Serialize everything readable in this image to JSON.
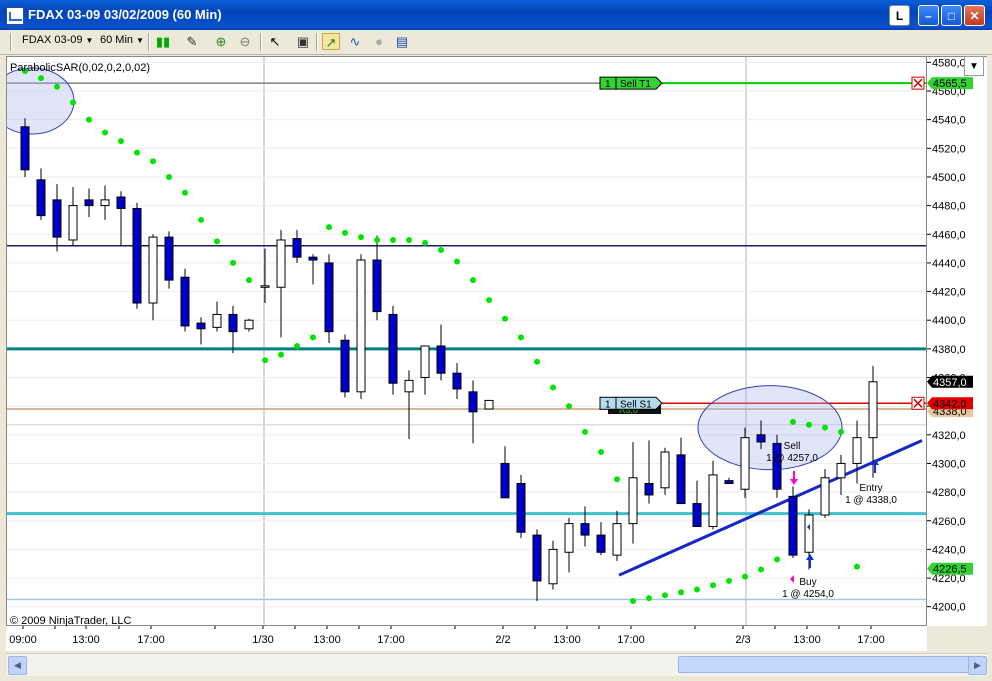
{
  "window": {
    "title": "FDAX 03-09  03/02/2009 (60 Min)",
    "btn_l": "L"
  },
  "toolbar": {
    "instrument": "FDAX 03-09",
    "interval": "60 Min"
  },
  "chart": {
    "indicator_label": "ParabolicSAR(0,02,0,2,0,02)",
    "copyright": "© 2009 NinjaTrader, LLC",
    "price_ticks": [
      "4580,0",
      "4560,0",
      "4540,0",
      "4520,0",
      "4500,0",
      "4480,0",
      "4460,0",
      "4440,0",
      "4420,0",
      "4400,0",
      "4380,0",
      "4360,0",
      "4340,0",
      "4320,0",
      "4300,0",
      "4280,0",
      "4260,0",
      "4240,0",
      "4220,0",
      "4200,0"
    ],
    "time_ticks": [
      "09:00",
      "13:00",
      "17:00",
      "1/30",
      "13:00",
      "17:00",
      "2/2",
      "13:00",
      "17:00",
      "2/3",
      "13:00",
      "17:00"
    ],
    "price_flags": {
      "last": "4357,0",
      "sell_target": "4565,5",
      "sell_stop": "4342,0",
      "sell_stop_back": "4338,0",
      "stop_green": "4226,5"
    },
    "order_tags": {
      "target_qty": "1",
      "target_label": "Sell T1",
      "stop_qty": "1",
      "stop_label": "Sell S1",
      "stop_under": "R3,0"
    },
    "annotations": {
      "sell_line1": "Sell",
      "sell_line2": "1 @ 4257,0",
      "buy_line1": "Buy",
      "buy_line2": "1 @ 4254,0",
      "entry_line1": "Entry",
      "entry_line2": "1 @ 4338,0"
    },
    "colors": {
      "sar": "#00E400",
      "bear_candle": "#0000CC",
      "teal_line": "#008080",
      "cyan_line": "#40C0D0",
      "trend_line": "#1428C8",
      "target_line": "#00D000",
      "stop_line": "#E00000"
    }
  },
  "chart_data": {
    "type": "candlestick",
    "y_range": [
      4190,
      4590
    ],
    "candles": [
      {
        "x": 24,
        "o": 4535,
        "h": 4541,
        "l": 4500,
        "c": 4505
      },
      {
        "x": 40,
        "o": 4498,
        "h": 4506,
        "l": 4470,
        "c": 4473
      },
      {
        "x": 56,
        "o": 4484,
        "h": 4495,
        "l": 4448,
        "c": 4458
      },
      {
        "x": 72,
        "o": 4456,
        "h": 4493,
        "l": 4452,
        "c": 4480
      },
      {
        "x": 88,
        "o": 4484,
        "h": 4492,
        "l": 4472,
        "c": 4480
      },
      {
        "x": 104,
        "o": 4480,
        "h": 4494,
        "l": 4470,
        "c": 4484
      },
      {
        "x": 120,
        "o": 4486,
        "h": 4490,
        "l": 4452,
        "c": 4478
      },
      {
        "x": 136,
        "o": 4478,
        "h": 4482,
        "l": 4408,
        "c": 4412
      },
      {
        "x": 152,
        "o": 4412,
        "h": 4460,
        "l": 4400,
        "c": 4458
      },
      {
        "x": 168,
        "o": 4458,
        "h": 4462,
        "l": 4422,
        "c": 4428
      },
      {
        "x": 184,
        "o": 4430,
        "h": 4436,
        "l": 4392,
        "c": 4396
      },
      {
        "x": 200,
        "o": 4398,
        "h": 4402,
        "l": 4383,
        "c": 4394
      },
      {
        "x": 216,
        "o": 4395,
        "h": 4413,
        "l": 4392,
        "c": 4404
      },
      {
        "x": 232,
        "o": 4404,
        "h": 4410,
        "l": 4377,
        "c": 4392
      },
      {
        "x": 248,
        "o": 4394,
        "h": 4401,
        "l": 4392,
        "c": 4400
      },
      {
        "x": 264,
        "o": 4423,
        "h": 4450,
        "l": 4412,
        "c": 4424
      },
      {
        "x": 280,
        "o": 4423,
        "h": 4463,
        "l": 4388,
        "c": 4456
      },
      {
        "x": 296,
        "o": 4457,
        "h": 4463,
        "l": 4440,
        "c": 4444
      },
      {
        "x": 312,
        "o": 4444,
        "h": 4446,
        "l": 4425,
        "c": 4442
      },
      {
        "x": 328,
        "o": 4440,
        "h": 4446,
        "l": 4384,
        "c": 4392
      },
      {
        "x": 344,
        "o": 4386,
        "h": 4390,
        "l": 4346,
        "c": 4350
      },
      {
        "x": 360,
        "o": 4350,
        "h": 4446,
        "l": 4345,
        "c": 4442
      },
      {
        "x": 376,
        "o": 4442,
        "h": 4459,
        "l": 4400,
        "c": 4406
      },
      {
        "x": 392,
        "o": 4404,
        "h": 4410,
        "l": 4348,
        "c": 4356
      },
      {
        "x": 408,
        "o": 4350,
        "h": 4365,
        "l": 4317,
        "c": 4358
      },
      {
        "x": 424,
        "o": 4360,
        "h": 4382,
        "l": 4348,
        "c": 4382
      },
      {
        "x": 440,
        "o": 4382,
        "h": 4397,
        "l": 4358,
        "c": 4363
      },
      {
        "x": 456,
        "o": 4363,
        "h": 4370,
        "l": 4345,
        "c": 4352
      },
      {
        "x": 472,
        "o": 4350,
        "h": 4358,
        "l": 4314,
        "c": 4336
      },
      {
        "x": 488,
        "o": 4338,
        "h": 4344,
        "l": 4338,
        "c": 4344
      },
      {
        "x": 504,
        "o": 4300,
        "h": 4312,
        "l": 4276,
        "c": 4276
      },
      {
        "x": 520,
        "o": 4286,
        "h": 4292,
        "l": 4248,
        "c": 4252
      },
      {
        "x": 536,
        "o": 4250,
        "h": 4254,
        "l": 4204,
        "c": 4218
      },
      {
        "x": 552,
        "o": 4216,
        "h": 4246,
        "l": 4212,
        "c": 4240
      },
      {
        "x": 568,
        "o": 4238,
        "h": 4262,
        "l": 4224,
        "c": 4258
      },
      {
        "x": 584,
        "o": 4258,
        "h": 4270,
        "l": 4242,
        "c": 4250
      },
      {
        "x": 600,
        "o": 4250,
        "h": 4259,
        "l": 4236,
        "c": 4238
      },
      {
        "x": 616,
        "o": 4236,
        "h": 4267,
        "l": 4232,
        "c": 4258
      },
      {
        "x": 632,
        "o": 4258,
        "h": 4315,
        "l": 4244,
        "c": 4290
      },
      {
        "x": 648,
        "o": 4286,
        "h": 4316,
        "l": 4272,
        "c": 4278
      },
      {
        "x": 664,
        "o": 4283,
        "h": 4311,
        "l": 4278,
        "c": 4308
      },
      {
        "x": 680,
        "o": 4306,
        "h": 4318,
        "l": 4276,
        "c": 4272
      },
      {
        "x": 696,
        "o": 4272,
        "h": 4288,
        "l": 4260,
        "c": 4256
      },
      {
        "x": 712,
        "o": 4256,
        "h": 4302,
        "l": 4254,
        "c": 4292
      },
      {
        "x": 728,
        "o": 4288,
        "h": 4290,
        "l": 4286,
        "c": 4286
      },
      {
        "x": 744,
        "o": 4282,
        "h": 4325,
        "l": 4276,
        "c": 4318
      },
      {
        "x": 760,
        "o": 4320,
        "h": 4330,
        "l": 4310,
        "c": 4315
      },
      {
        "x": 776,
        "o": 4314,
        "h": 4320,
        "l": 4276,
        "c": 4282
      },
      {
        "x": 792,
        "o": 4277,
        "h": 4284,
        "l": 4234,
        "c": 4236
      },
      {
        "x": 808,
        "o": 4238,
        "h": 4268,
        "l": 4226,
        "c": 4264
      },
      {
        "x": 824,
        "o": 4264,
        "h": 4296,
        "l": 4262,
        "c": 4290
      },
      {
        "x": 840,
        "o": 4290,
        "h": 4306,
        "l": 4278,
        "c": 4300
      },
      {
        "x": 856,
        "o": 4300,
        "h": 4330,
        "l": 4286,
        "c": 4318
      },
      {
        "x": 872,
        "o": 4318,
        "h": 4368,
        "l": 4290,
        "c": 4357
      }
    ],
    "sar": [
      {
        "x": 24,
        "v": 4574
      },
      {
        "x": 40,
        "v": 4569
      },
      {
        "x": 56,
        "v": 4563
      },
      {
        "x": 72,
        "v": 4552
      },
      {
        "x": 88,
        "v": 4540
      },
      {
        "x": 104,
        "v": 4531
      },
      {
        "x": 120,
        "v": 4525
      },
      {
        "x": 136,
        "v": 4517
      },
      {
        "x": 152,
        "v": 4511
      },
      {
        "x": 168,
        "v": 4500
      },
      {
        "x": 184,
        "v": 4489
      },
      {
        "x": 200,
        "v": 4470
      },
      {
        "x": 216,
        "v": 4455
      },
      {
        "x": 232,
        "v": 4440
      },
      {
        "x": 248,
        "v": 4428
      },
      {
        "x": 264,
        "v": 4372
      },
      {
        "x": 280,
        "v": 4376
      },
      {
        "x": 296,
        "v": 4382
      },
      {
        "x": 312,
        "v": 4388
      },
      {
        "x": 328,
        "v": 4465
      },
      {
        "x": 344,
        "v": 4461
      },
      {
        "x": 360,
        "v": 4458
      },
      {
        "x": 376,
        "v": 4456
      },
      {
        "x": 392,
        "v": 4456
      },
      {
        "x": 408,
        "v": 4456
      },
      {
        "x": 424,
        "v": 4454
      },
      {
        "x": 440,
        "v": 4449
      },
      {
        "x": 456,
        "v": 4441
      },
      {
        "x": 472,
        "v": 4428
      },
      {
        "x": 488,
        "v": 4414
      },
      {
        "x": 504,
        "v": 4401
      },
      {
        "x": 520,
        "v": 4388
      },
      {
        "x": 536,
        "v": 4371
      },
      {
        "x": 552,
        "v": 4353
      },
      {
        "x": 568,
        "v": 4340
      },
      {
        "x": 584,
        "v": 4322
      },
      {
        "x": 600,
        "v": 4308
      },
      {
        "x": 616,
        "v": 4289
      },
      {
        "x": 632,
        "v": 4204
      },
      {
        "x": 648,
        "v": 4206
      },
      {
        "x": 664,
        "v": 4208
      },
      {
        "x": 680,
        "v": 4210
      },
      {
        "x": 696,
        "v": 4212
      },
      {
        "x": 712,
        "v": 4215
      },
      {
        "x": 728,
        "v": 4218
      },
      {
        "x": 744,
        "v": 4221
      },
      {
        "x": 760,
        "v": 4226
      },
      {
        "x": 776,
        "v": 4233
      },
      {
        "x": 792,
        "v": 4329
      },
      {
        "x": 808,
        "v": 4327
      },
      {
        "x": 824,
        "v": 4325
      },
      {
        "x": 840,
        "v": 4322
      },
      {
        "x": 856,
        "v": 4228
      }
    ],
    "horizontal_lines": [
      {
        "price": 4565.5,
        "color": "#00D000",
        "label": "Sell T1"
      },
      {
        "price": 4452,
        "color": "#1A1A60"
      },
      {
        "price": 4380,
        "color": "#008080"
      },
      {
        "price": 4342,
        "color": "#E00000",
        "label": "Sell S1"
      },
      {
        "price": 4338,
        "color": "#C8A070"
      },
      {
        "price": 4265,
        "color": "#40C0D0"
      },
      {
        "price": 4205,
        "color": "#A0C8E0"
      }
    ]
  }
}
